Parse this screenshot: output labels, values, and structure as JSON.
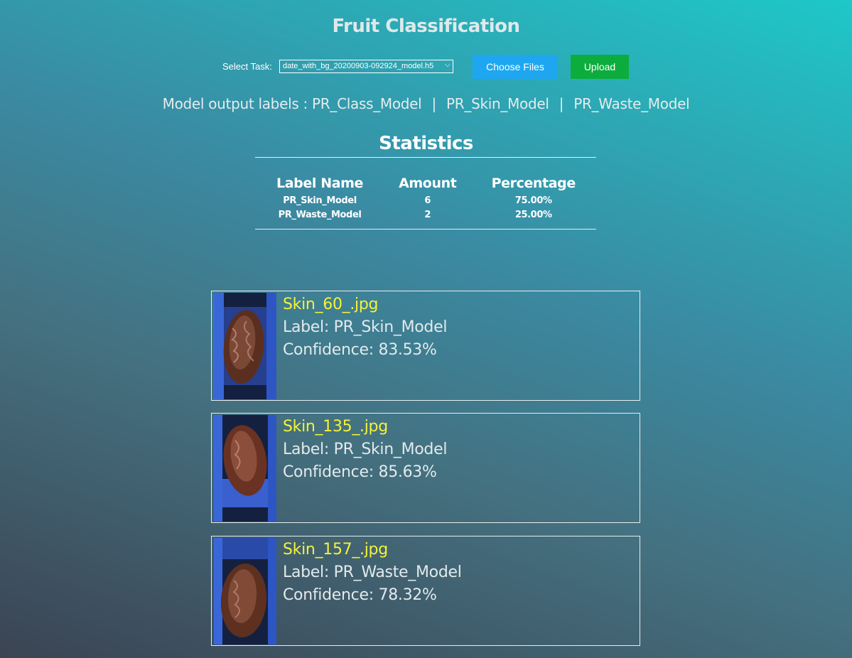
{
  "app": {
    "title": "Fruit Classification"
  },
  "controls": {
    "task_label": "Select Task:",
    "task_selected": "date_with_bg_20200903-092924_model.h5",
    "choose_files_label": "Choose Files",
    "upload_label": "Upload"
  },
  "model_labels": {
    "prefix": "Model output labels :",
    "items": [
      "PR_Class_Model",
      "PR_Skin_Model",
      "PR_Waste_Model"
    ],
    "separator": "|"
  },
  "statistics": {
    "title": "Statistics",
    "headers": [
      "Label Name",
      "Amount",
      "Percentage"
    ],
    "rows": [
      [
        "PR_Skin_Model",
        "6",
        "75.00%"
      ],
      [
        "PR_Waste_Model",
        "2",
        "25.00%"
      ]
    ]
  },
  "results": [
    {
      "filename": "Skin_60_.jpg",
      "label_prefix": "Label:",
      "label": "PR_Skin_Model",
      "confidence_prefix": "Confidence:",
      "confidence": "83.53%"
    },
    {
      "filename": "Skin_135_.jpg",
      "label_prefix": "Label:",
      "label": "PR_Skin_Model",
      "confidence_prefix": "Confidence:",
      "confidence": "85.63%"
    },
    {
      "filename": "Skin_157_.jpg",
      "label_prefix": "Label:",
      "label": "PR_Waste_Model",
      "confidence_prefix": "Confidence:",
      "confidence": "78.32%"
    }
  ],
  "colors": {
    "choose_button": "#1ea7f0",
    "upload_button": "#0cad3c",
    "filename_text": "#f4f23a"
  }
}
